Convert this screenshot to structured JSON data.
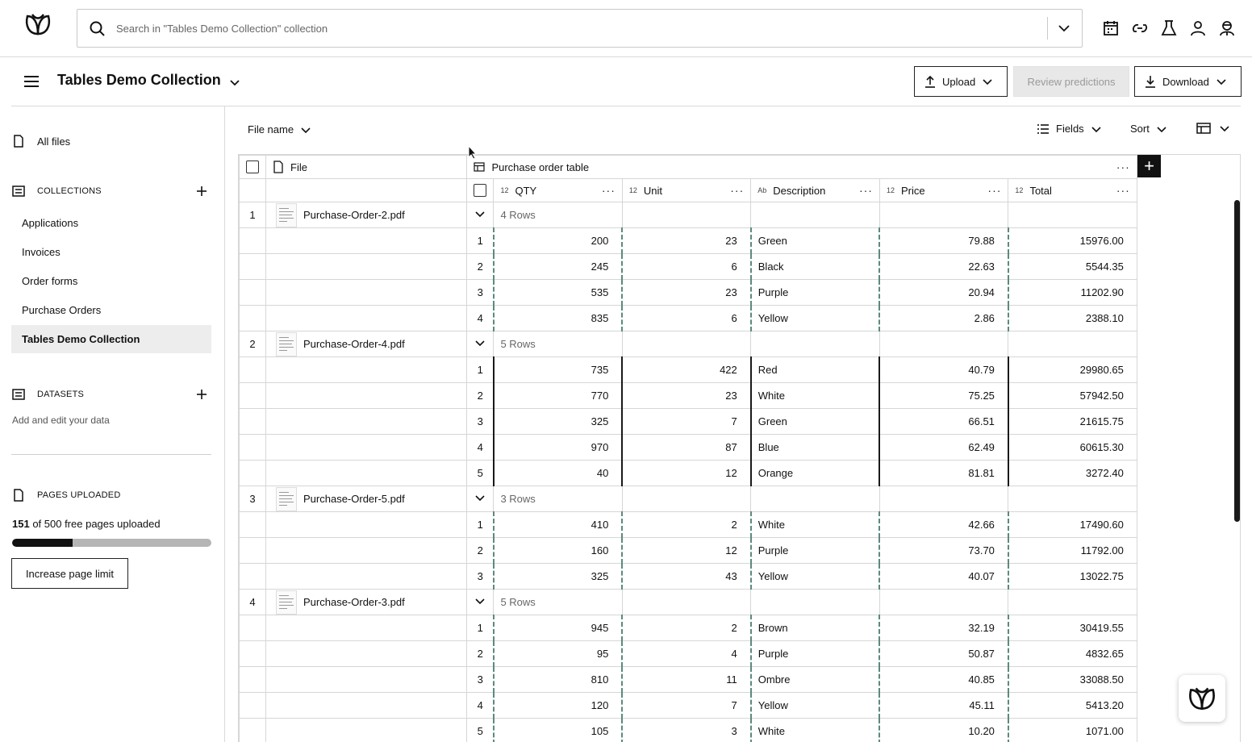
{
  "search": {
    "placeholder": "Search in \"Tables Demo Collection\" collection"
  },
  "top_icons": [
    "calendar-icon",
    "link-icon",
    "flask-icon",
    "user-icon",
    "agent-icon"
  ],
  "collection": {
    "title": "Tables Demo Collection"
  },
  "actions": {
    "upload": "Upload",
    "review": "Review predictions",
    "download": "Download"
  },
  "sidebar": {
    "all_files": "All files",
    "collections_label": "COLLECTIONS",
    "collections": [
      {
        "label": "Applications",
        "active": false
      },
      {
        "label": "Invoices",
        "active": false
      },
      {
        "label": "Order forms",
        "active": false
      },
      {
        "label": "Purchase Orders",
        "active": false
      },
      {
        "label": "Tables Demo Collection",
        "active": true
      }
    ],
    "datasets_label": "DATASETS",
    "datasets_hint": "Add and edit your data",
    "pages_label": "PAGES UPLOADED",
    "pages_used": "151",
    "pages_rest": " of 500 free pages uploaded",
    "pages_fraction": 0.302,
    "increase_button": "Increase page limit"
  },
  "toolbar": {
    "file_name": "File name",
    "fields": "Fields",
    "sort": "Sort"
  },
  "table": {
    "file_header": "File",
    "group_header": "Purchase order table",
    "columns": [
      {
        "tag": "12",
        "label": "QTY"
      },
      {
        "tag": "12",
        "label": "Unit"
      },
      {
        "tag": "Ab",
        "label": "Description"
      },
      {
        "tag": "12",
        "label": "Price"
      },
      {
        "tag": "12",
        "label": "Total"
      }
    ],
    "files": [
      {
        "index": "1",
        "name": "Purchase-Order-2.pdf",
        "rows_label": "4 Rows",
        "border": "dashed",
        "rows": [
          [
            "1",
            "200",
            "23",
            "Green",
            "79.88",
            "15976.00"
          ],
          [
            "2",
            "245",
            "6",
            "Black",
            "22.63",
            "5544.35"
          ],
          [
            "3",
            "535",
            "23",
            "Purple",
            "20.94",
            "11202.90"
          ],
          [
            "4",
            "835",
            "6",
            "Yellow",
            "2.86",
            "2388.10"
          ]
        ]
      },
      {
        "index": "2",
        "name": "Purchase-Order-4.pdf",
        "rows_label": "5 Rows",
        "border": "solid",
        "rows": [
          [
            "1",
            "735",
            "422",
            "Red",
            "40.79",
            "29980.65"
          ],
          [
            "2",
            "770",
            "23",
            "White",
            "75.25",
            "57942.50"
          ],
          [
            "3",
            "325",
            "7",
            "Green",
            "66.51",
            "21615.75"
          ],
          [
            "4",
            "970",
            "87",
            "Blue",
            "62.49",
            "60615.30"
          ],
          [
            "5",
            "40",
            "12",
            "Orange",
            "81.81",
            "3272.40"
          ]
        ]
      },
      {
        "index": "3",
        "name": "Purchase-Order-5.pdf",
        "rows_label": "3 Rows",
        "border": "dashed",
        "rows": [
          [
            "1",
            "410",
            "2",
            "White",
            "42.66",
            "17490.60"
          ],
          [
            "2",
            "160",
            "12",
            "Purple",
            "73.70",
            "11792.00"
          ],
          [
            "3",
            "325",
            "43",
            "Yellow",
            "40.07",
            "13022.75"
          ]
        ]
      },
      {
        "index": "4",
        "name": "Purchase-Order-3.pdf",
        "rows_label": "5 Rows",
        "border": "dashed",
        "rows": [
          [
            "1",
            "945",
            "2",
            "Brown",
            "32.19",
            "30419.55"
          ],
          [
            "2",
            "95",
            "4",
            "Purple",
            "50.87",
            "4832.65"
          ],
          [
            "3",
            "810",
            "11",
            "Ombre",
            "40.85",
            "33088.50"
          ],
          [
            "4",
            "120",
            "7",
            "Yellow",
            "45.11",
            "5413.20"
          ],
          [
            "5",
            "105",
            "3",
            "White",
            "10.20",
            "1071.00"
          ]
        ]
      }
    ]
  },
  "colors": {
    "accent_dashed": "#5c8a7e",
    "dark": "#111111",
    "progress_track": "#b5b5b5"
  }
}
